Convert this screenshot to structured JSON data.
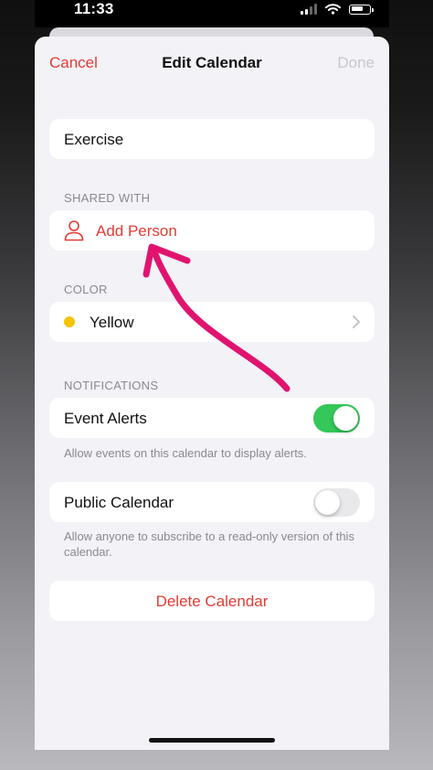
{
  "status_bar": {
    "time": "11:33"
  },
  "nav": {
    "cancel": "Cancel",
    "title": "Edit Calendar",
    "done": "Done"
  },
  "calendar_name": "Exercise",
  "shared_with": {
    "header": "SHARED WITH",
    "add_person": "Add Person"
  },
  "color": {
    "header": "COLOR",
    "value": "Yellow",
    "swatch": "#f5c400"
  },
  "notifications": {
    "header": "NOTIFICATIONS",
    "event_alerts_label": "Event Alerts",
    "event_alerts_on": true,
    "event_alerts_note": "Allow events on this calendar to display alerts."
  },
  "public_calendar": {
    "label": "Public Calendar",
    "on": false,
    "note": "Allow anyone to subscribe to a read-only version of this calendar."
  },
  "delete_label": "Delete Calendar",
  "colors": {
    "accent": "#e23b33",
    "toggle_on": "#34c759",
    "annotation": "#e0146f"
  }
}
